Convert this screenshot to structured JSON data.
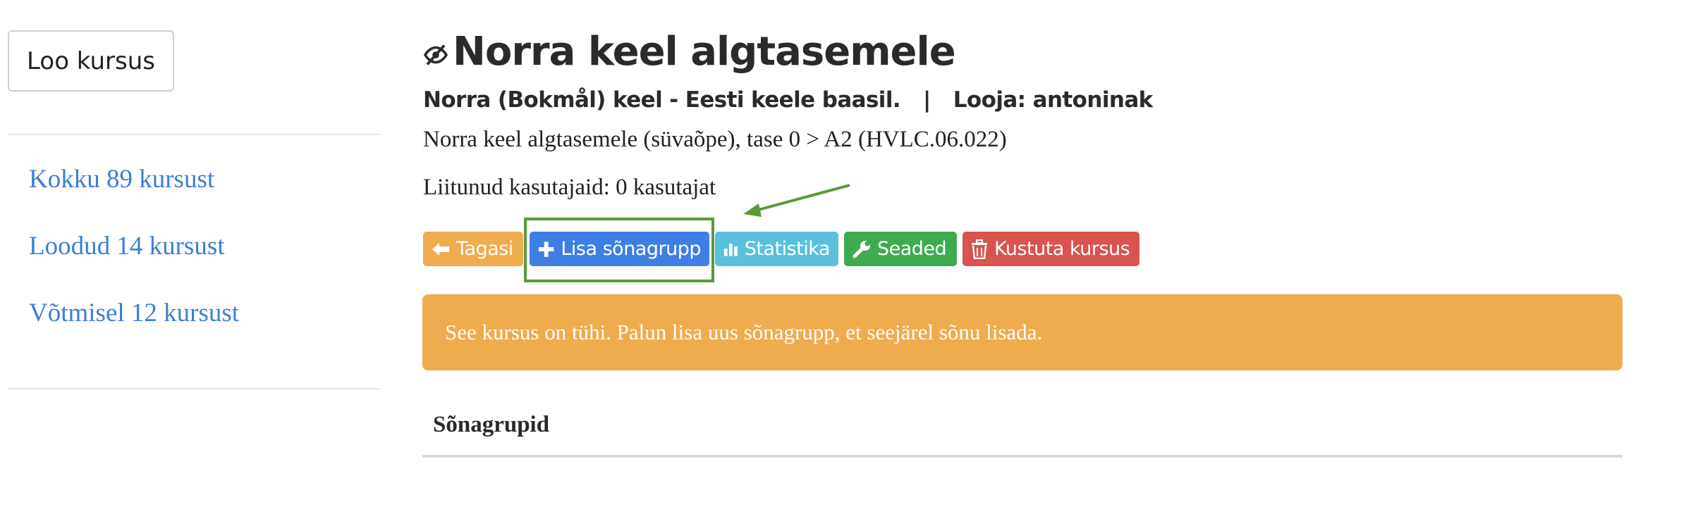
{
  "sidebar": {
    "create_button": "Loo kursus",
    "links": [
      {
        "label": "Kokku 89 kursust"
      },
      {
        "label": "Loodud 14 kursust"
      },
      {
        "label": "Võtmisel 12 kursust"
      }
    ]
  },
  "course": {
    "title": "Norra keel algtasemele",
    "language": "Norra (Bokmål) keel - Eesti keele baasil.",
    "separator": "|",
    "creator": "Looja: antoninak",
    "description": "Norra keel algtasemele (süvaõpe), tase 0 > A2 (HVLC.06.022)",
    "joined": "Liitunud kasutajaid: 0 kasutajat"
  },
  "actions": {
    "back": "Tagasi",
    "add_group": "Lisa sõnagrupp",
    "statistics": "Statistika",
    "settings": "Seaded",
    "delete": "Kustuta kursus"
  },
  "alert": {
    "message": "See kursus on tühi. Palun lisa uus sõnagrupp, et seejärel sõnu lisada."
  },
  "section": {
    "heading": "Sõnagrupid"
  },
  "icons": [
    "eye-slash-icon",
    "arrow-left-icon",
    "plus-icon",
    "bar-chart-icon",
    "wrench-icon",
    "trash-icon"
  ],
  "colors": {
    "link": "#3a7fd6",
    "back": "#efac4e",
    "add": "#3e7fe3",
    "stats": "#5bc0de",
    "settings": "#3fab4f",
    "delete": "#d9534f",
    "alert": "#efac4e",
    "annotation": "#5a9a3a"
  }
}
